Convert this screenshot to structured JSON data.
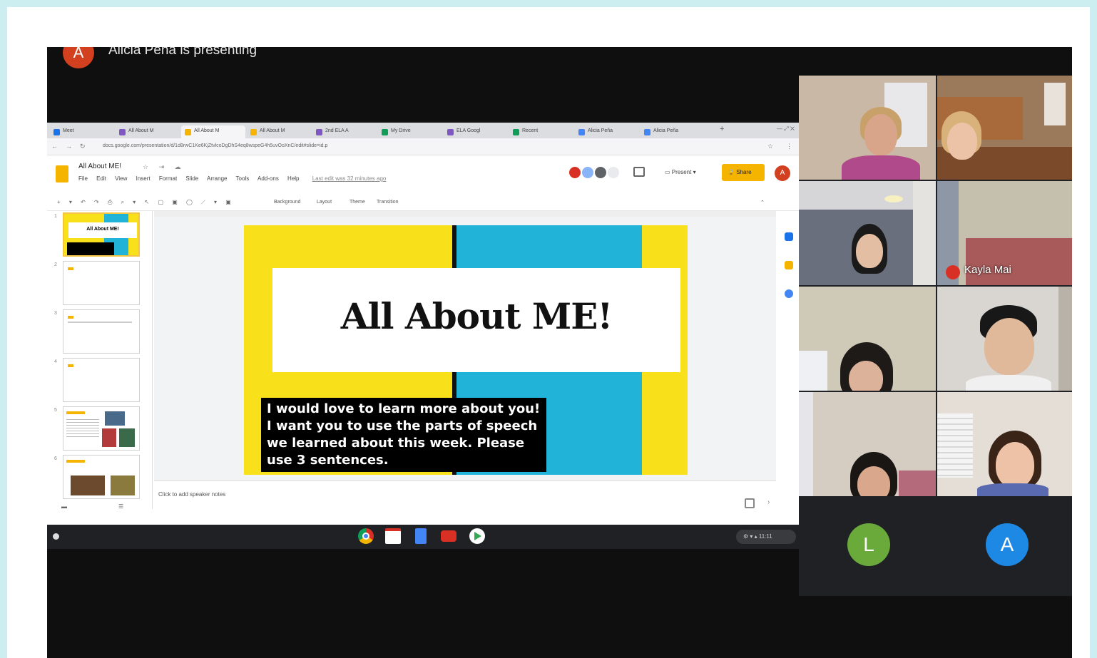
{
  "presenter": {
    "initial": "A",
    "text": "Alicia Peña is presenting"
  },
  "browser": {
    "tabs": [
      {
        "label": "Meet",
        "color": "#1a73e8"
      },
      {
        "label": "All About M",
        "color": "#7e57c2"
      },
      {
        "label": "All About M",
        "color": "#f4b400"
      },
      {
        "label": "All About M",
        "color": "#f4b400"
      },
      {
        "label": "2nd ELA A",
        "color": "#7e57c2"
      },
      {
        "label": "My Drive",
        "color": "#0f9d58"
      },
      {
        "label": "ELA Googl",
        "color": "#7e57c2"
      },
      {
        "label": "Recent",
        "color": "#0f9d58"
      },
      {
        "label": "Alicia Peña",
        "color": "#4285f4"
      },
      {
        "label": "Alicia Peña",
        "color": "#4285f4"
      }
    ],
    "url": "docs.google.com/presentation/d/1d8rwC1Ke6KjZtvlcoDgDhS4eq8wspeG4h5uvOoXnC/edit#slide=id.p"
  },
  "slides_app": {
    "doc_title": "All About ME!",
    "menu": [
      "File",
      "Edit",
      "View",
      "Insert",
      "Format",
      "Slide",
      "Arrange",
      "Tools",
      "Add-ons",
      "Help"
    ],
    "last_edit": "Last edit was 32 minutes ago",
    "present_label": "Present",
    "share_label": "Share",
    "account_initial": "A",
    "toolbar_labels": [
      "Background",
      "Layout",
      "Theme",
      "Transition"
    ],
    "thumb_numbers": [
      "1",
      "2",
      "3",
      "4",
      "5",
      "6"
    ],
    "thumb1_title": "All About ME!",
    "speaker_notes_placeholder": "Click to add speaker notes"
  },
  "slide": {
    "title": "All About ME!",
    "body": "I would love to learn more about you! I want you to use the parts of speech we learned about this week. Please use 3 sentences."
  },
  "participants": {
    "muted_name": "Kayla Mai",
    "avatar_l": "L",
    "avatar_a": "A"
  },
  "system_tray": {
    "time": "11:11"
  },
  "colors": {
    "yellow": "#f8e11a",
    "blue": "#22b3d9",
    "avatar_l": "#6aaa3a",
    "avatar_a": "#1e88e5"
  }
}
